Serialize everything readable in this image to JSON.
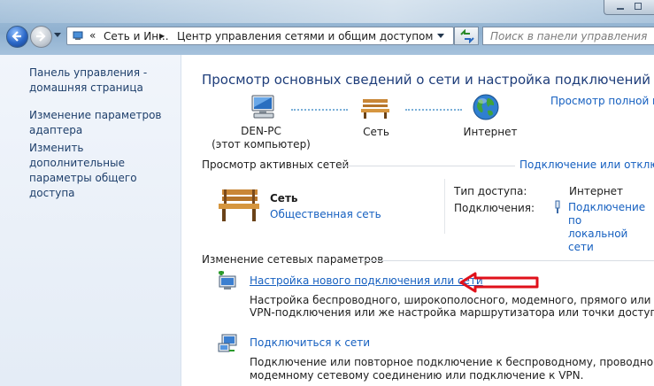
{
  "address_bar": {
    "crumb_prefix": "«",
    "crumb_1": "Сеть и Ин...",
    "crumb_separator": "▶",
    "crumb_2": "Центр управления сетями и общим доступом"
  },
  "search": {
    "placeholder": "Поиск в панели управления"
  },
  "left_pane": {
    "items": [
      {
        "label": "Панель управления -\nдомашняя страница"
      },
      {
        "label": "Изменение параметров\nадаптера"
      },
      {
        "label": "Изменить дополнительные\nпараметры общего доступа"
      }
    ]
  },
  "main": {
    "title": "Просмотр основных сведений о сети и настройка подключений",
    "full_map_link": "Просмотр полной ка",
    "map": {
      "computer_name": "DEN-PC",
      "computer_sub": "(этот компьютер)",
      "network": "Сеть",
      "internet": "Интернет"
    },
    "active": {
      "section_title": "Просмотр активных сетей",
      "connect_link": "Подключение или отключе",
      "network_name": "Сеть",
      "network_type": "Общественная сеть",
      "access_type_label": "Тип доступа:",
      "access_type_value": "Интернет",
      "connections_label": "Подключения:",
      "connection_value": "Подключение по\nлокальной сети"
    },
    "change": {
      "section_title": "Изменение сетевых параметров",
      "items": [
        {
          "title": "Настройка нового подключения или сети",
          "desc_1": "Настройка беспроводного, широкополосного, модемного, прямого или",
          "desc_2": "VPN-подключения или же настройка маршрутизатора или точки доступа."
        },
        {
          "title": "Подключиться к сети",
          "desc_1": "Подключение или повторное подключение к беспроводному, проводному,",
          "desc_2": "модемному сетевому соединению или подключение к VPN."
        }
      ]
    }
  },
  "colors": {
    "link": "#1660c0",
    "title": "#1e3d7a",
    "annotation_arrow": "#e0101a"
  }
}
